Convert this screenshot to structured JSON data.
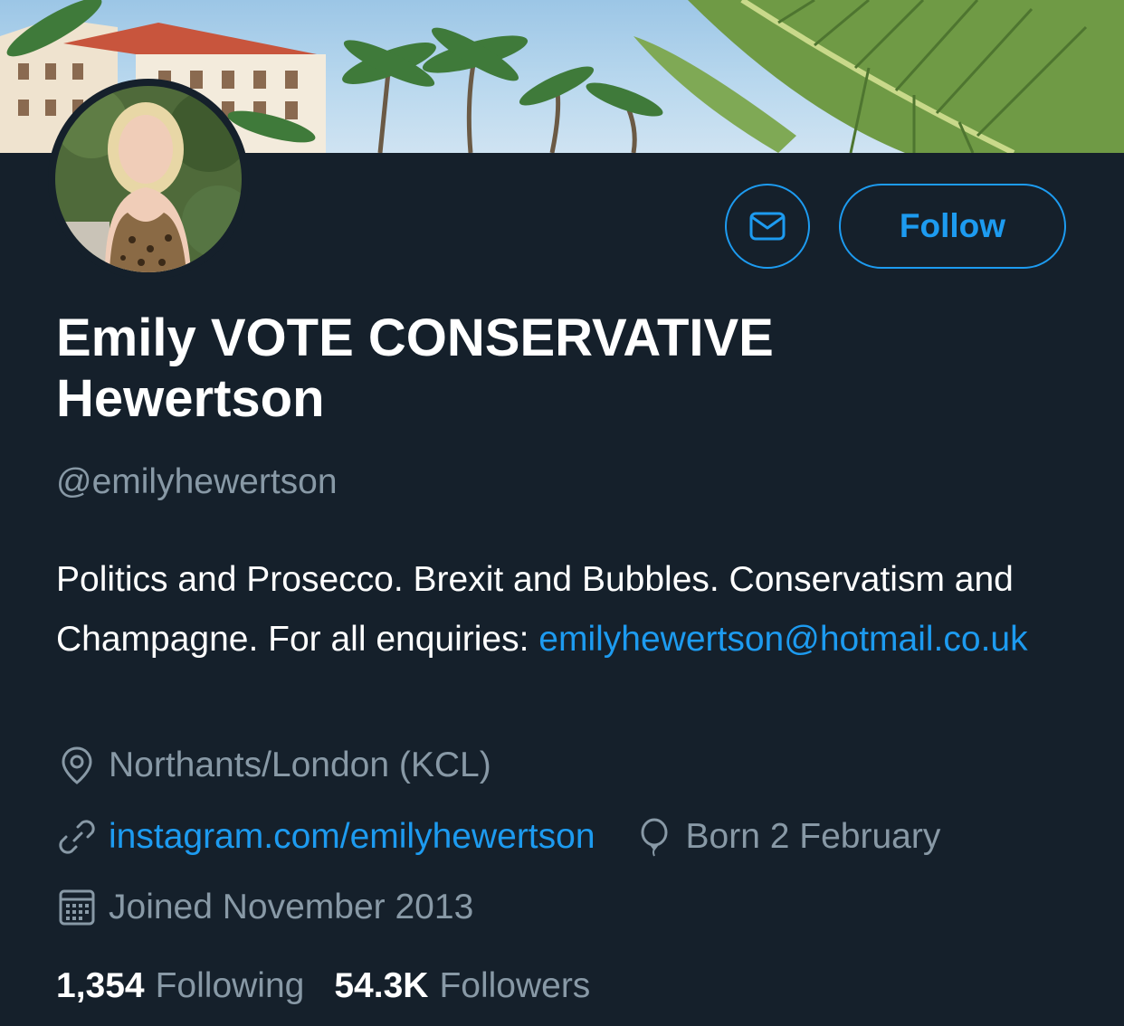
{
  "profile": {
    "name": "Emily VOTE CONSERVATIVE Hewertson",
    "handle": "@emilyhewertson",
    "bio_text": "Politics and Prosecco. Brexit and Bubbles. Conservatism and Champagne. For all enquiries:",
    "bio_email": "emilyhewertson@hotmail.co.uk",
    "location": "Northants/London (KCL)",
    "website": "instagram.com/emilyhewertson",
    "birthday": "Born 2 February",
    "joined": "Joined November 2013"
  },
  "actions": {
    "message_icon": "envelope-icon",
    "follow_label": "Follow"
  },
  "stats": {
    "following_count": "1,354",
    "following_label": "Following",
    "followers_count": "54.3K",
    "followers_label": "Followers"
  },
  "icons": {
    "location": "location-pin-icon",
    "link": "link-icon",
    "birthday": "balloon-icon",
    "joined": "calendar-icon"
  },
  "colors": {
    "background": "#15202b",
    "accent": "#1d9bf0",
    "secondary_text": "#8899a6",
    "primary_text": "#ffffff"
  }
}
